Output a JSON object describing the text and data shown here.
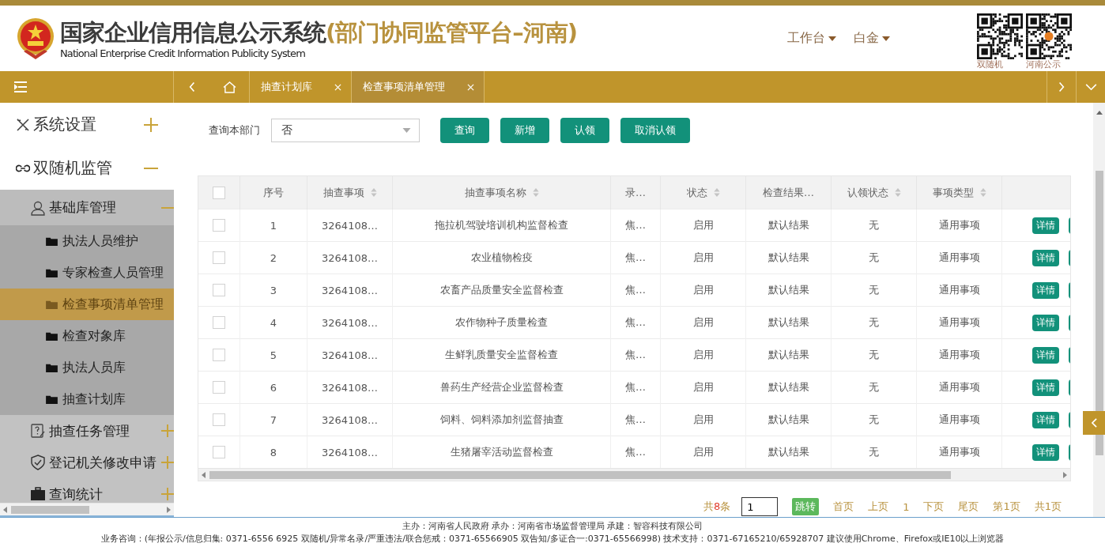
{
  "header": {
    "title": "国家企业信用信息公示系统",
    "title_suffix": "(部门协同监管平台–河南)",
    "subtitle": "National Enterprise Credit Information Publicity System",
    "menus": [
      {
        "label": "工作台"
      },
      {
        "label": "白金"
      }
    ],
    "qr_codes": [
      {
        "caption": "双随机"
      },
      {
        "caption": "河南公示"
      }
    ]
  },
  "tabs": [
    {
      "label": "抽查计划库",
      "selected": false
    },
    {
      "label": "检查事项清单管理",
      "selected": true
    }
  ],
  "sidebar": {
    "items": [
      {
        "label": "系统设置",
        "expanded": false
      },
      {
        "label": "双随机监管",
        "expanded": true,
        "children": [
          {
            "label": "基础库管理",
            "expanded": true,
            "children": [
              {
                "label": "执法人员维护",
                "selected": false
              },
              {
                "label": "专家检查人员管理",
                "selected": false
              },
              {
                "label": "检查事项清单管理",
                "selected": true
              },
              {
                "label": "检查对象库",
                "selected": false
              },
              {
                "label": "执法人员库",
                "selected": false
              },
              {
                "label": "抽查计划库",
                "selected": false
              }
            ]
          },
          {
            "label": "抽查任务管理",
            "expanded": false
          },
          {
            "label": "登记机关修改申请",
            "expanded": false
          },
          {
            "label": "查询统计",
            "expanded": false
          }
        ]
      }
    ]
  },
  "filter": {
    "label": "查询本部门",
    "value": "否"
  },
  "buttons": [
    "查询",
    "新增",
    "认领",
    "取消认领"
  ],
  "table": {
    "columns": [
      {
        "label": "序号",
        "sortable": false
      },
      {
        "label": "抽查事项",
        "sortable": true
      },
      {
        "label": "抽查事项名称",
        "sortable": true
      },
      {
        "label": "录…",
        "sortable": false
      },
      {
        "label": "状态",
        "sortable": true
      },
      {
        "label": "检查结果…",
        "sortable": false
      },
      {
        "label": "认领状态",
        "sortable": true
      },
      {
        "label": "事项类型",
        "sortable": true
      }
    ],
    "all_checked": false,
    "rows": [
      {
        "checked": false,
        "cells": [
          "1",
          "3264108…",
          "拖拉机驾驶培训机构监督检查",
          "焦…",
          "启用",
          "默认结果",
          "无",
          "通用事项"
        ],
        "action": "详情"
      },
      {
        "checked": false,
        "cells": [
          "2",
          "3264108…",
          "农业植物检疫",
          "焦…",
          "启用",
          "默认结果",
          "无",
          "通用事项"
        ],
        "action": "详情"
      },
      {
        "checked": false,
        "cells": [
          "3",
          "3264108…",
          "农畜产品质量安全监督检查",
          "焦…",
          "启用",
          "默认结果",
          "无",
          "通用事项"
        ],
        "action": "详情"
      },
      {
        "checked": false,
        "cells": [
          "4",
          "3264108…",
          "农作物种子质量检查",
          "焦…",
          "启用",
          "默认结果",
          "无",
          "通用事项"
        ],
        "action": "详情"
      },
      {
        "checked": false,
        "cells": [
          "5",
          "3264108…",
          "生鲜乳质量安全监督检查",
          "焦…",
          "启用",
          "默认结果",
          "无",
          "通用事项"
        ],
        "action": "详情"
      },
      {
        "checked": false,
        "cells": [
          "6",
          "3264108…",
          "兽药生产经营企业监督检查",
          "焦…",
          "启用",
          "默认结果",
          "无",
          "通用事项"
        ],
        "action": "详情"
      },
      {
        "checked": false,
        "cells": [
          "7",
          "3264108…",
          "饲料、饲料添加剂监督抽查",
          "焦…",
          "启用",
          "默认结果",
          "无",
          "通用事项"
        ],
        "action": "详情"
      },
      {
        "checked": false,
        "cells": [
          "8",
          "3264108…",
          "生猪屠宰活动监督检查",
          "焦…",
          "启用",
          "默认结果",
          "无",
          "通用事项"
        ],
        "action": "详情"
      }
    ]
  },
  "pagination": {
    "total_prefix": "共",
    "total_count": "8",
    "total_suffix": "条",
    "page_input": "1",
    "jump": "跳转",
    "links": [
      "首页",
      "上页",
      "1",
      "下页",
      "尾页",
      "第1页",
      "共1页"
    ]
  },
  "footer": {
    "line_1": "主办：河南省人民政府  承办：河南省市场监督管理局  承建：智容科技有限公司",
    "line_2": "业务咨询：(年报公示/信息归集: 0371-6556 6925    双随机/异常名录/严重违法/联合惩戒：0371-65566905    双告知/多证合一:0371-65566998)    技术支持：0371-67165210/65928707   建议使用Chrome、Firefox或IE10以上浏览器"
  }
}
